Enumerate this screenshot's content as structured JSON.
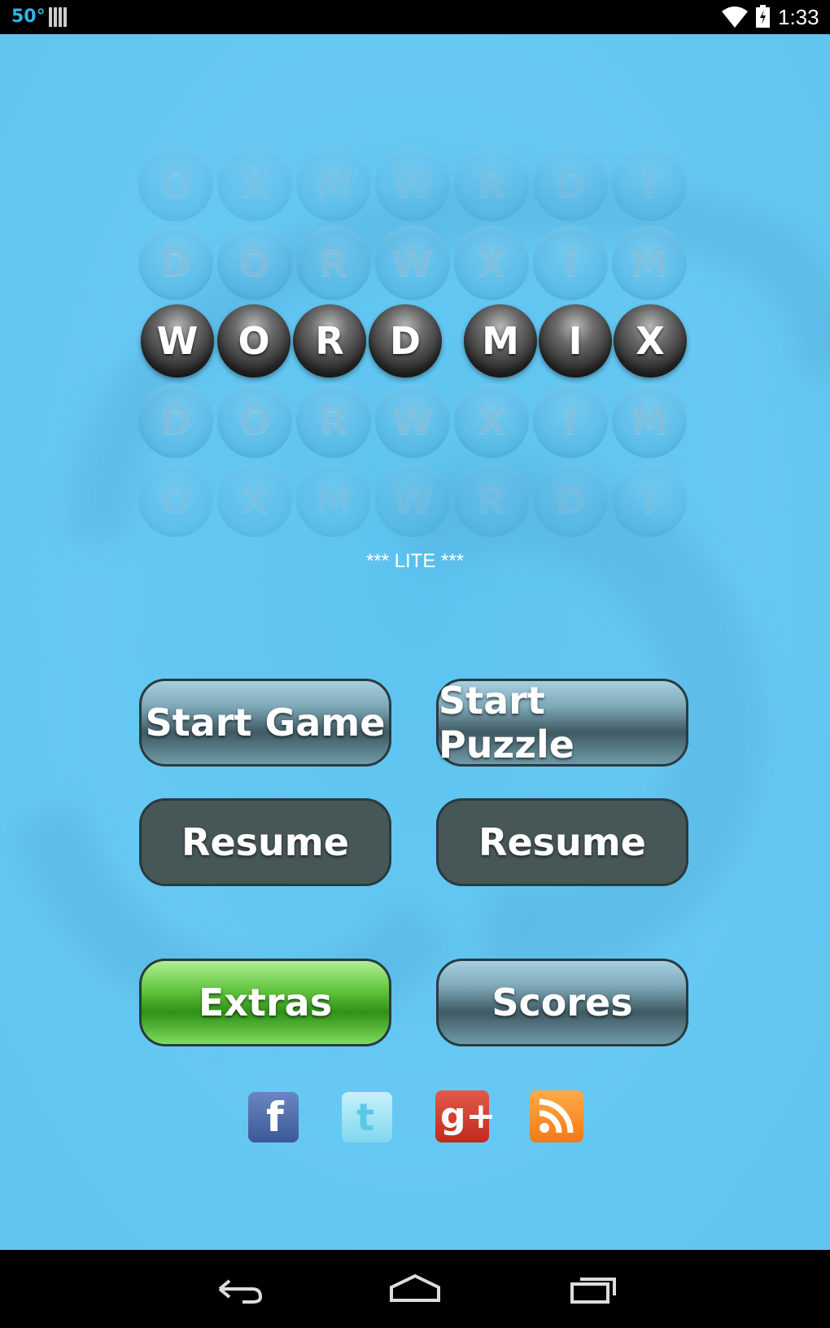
{
  "status_bar": {
    "temperature": "50°",
    "time": "1:33",
    "icons": [
      "barcode-icon",
      "wifi-icon",
      "battery-charging-icon"
    ]
  },
  "logo": {
    "rows": [
      [
        "O",
        "X",
        "M",
        "W",
        "R",
        "D",
        "I"
      ],
      [
        "D",
        "O",
        "R",
        "W",
        "X",
        "I",
        "M"
      ],
      [
        "W",
        "O",
        "R",
        "D",
        "",
        "M",
        "I",
        "X"
      ],
      [
        "D",
        "O",
        "R",
        "W",
        "X",
        "I",
        "M"
      ],
      [
        "O",
        "X",
        "M",
        "W",
        "R",
        "D",
        "I"
      ]
    ],
    "title_left": [
      "W",
      "O",
      "R",
      "D"
    ],
    "title_right": [
      "M",
      "I",
      "X"
    ],
    "edition": "*** LITE ***"
  },
  "buttons": {
    "start_game": "Start Game",
    "start_puzzle": "Start Puzzle",
    "resume_game": "Resume",
    "resume_puzzle": "Resume",
    "extras": "Extras",
    "scores": "Scores"
  },
  "social": [
    "facebook-icon",
    "twitter-icon",
    "google-plus-icon",
    "rss-icon"
  ],
  "nav": [
    "back-icon",
    "home-icon",
    "recent-apps-icon"
  ],
  "colors": {
    "background": "#66c8f3",
    "button_glass": "#7fa9b8",
    "button_dark": "#475656",
    "button_green": "#63c53e"
  }
}
